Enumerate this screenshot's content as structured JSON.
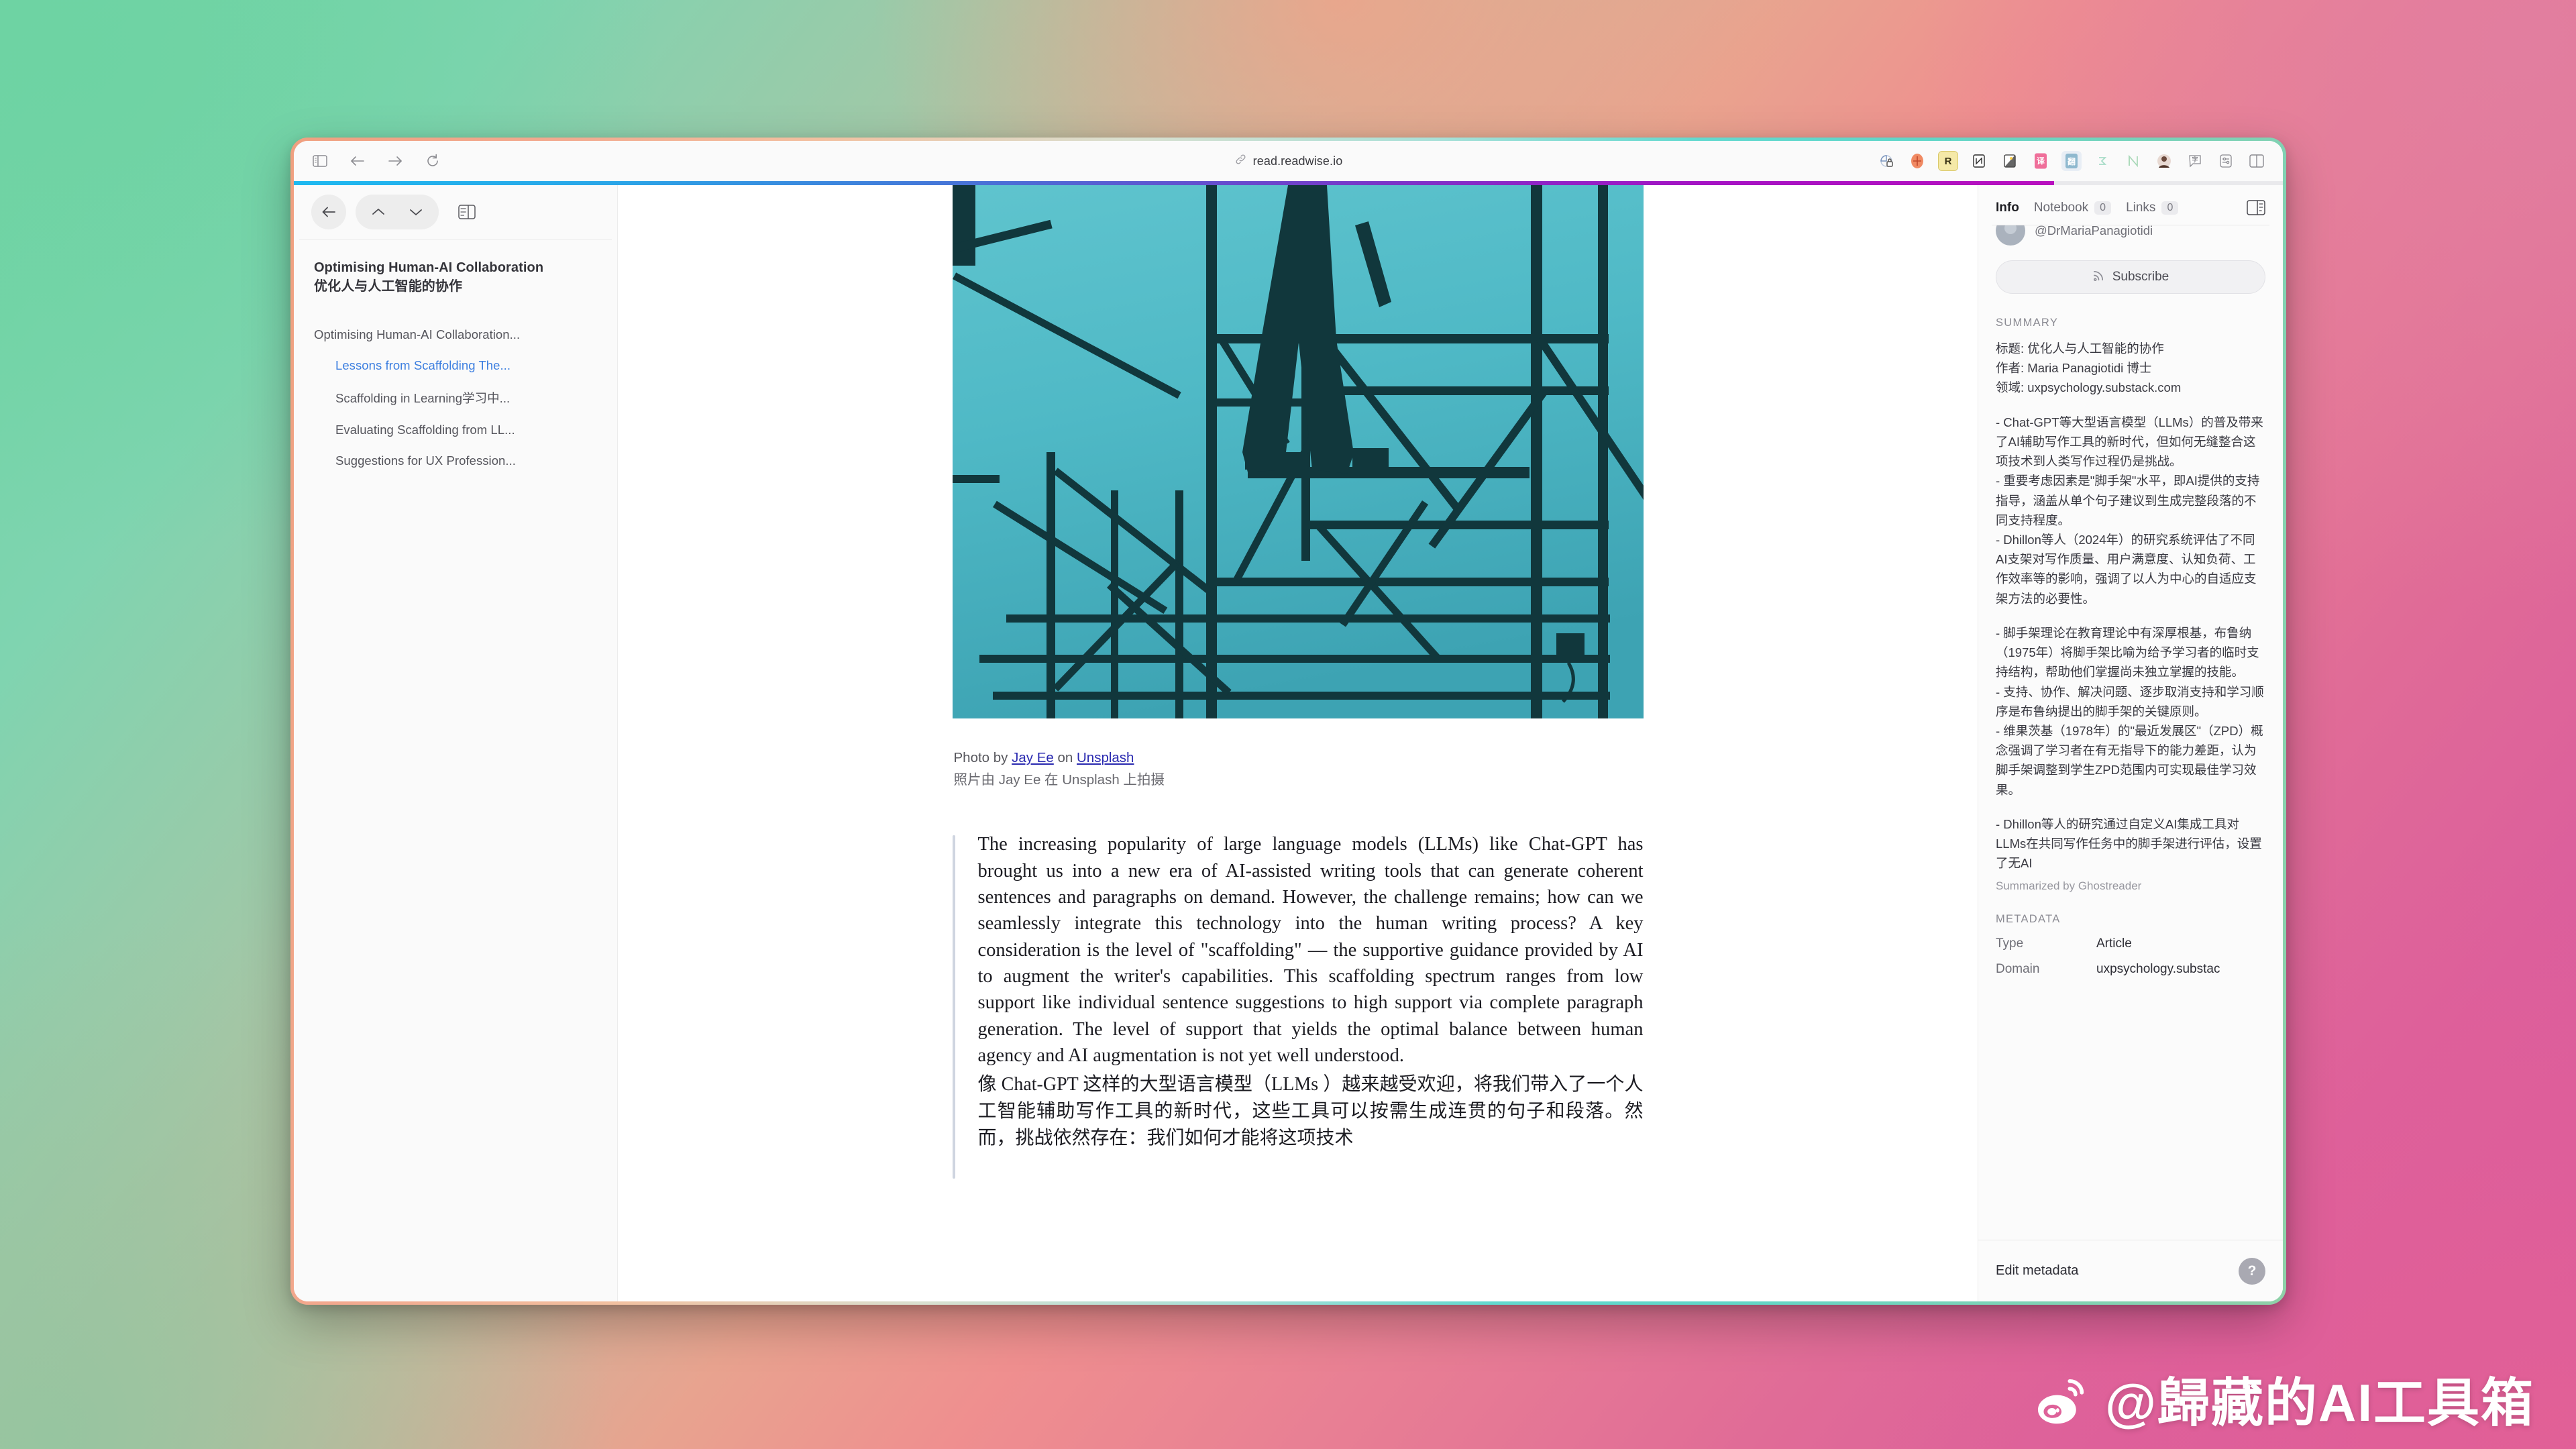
{
  "browser": {
    "url": "read.readwise.io",
    "nav": {
      "sidebar_toggle": "sidebar-toggle",
      "back": "back",
      "forward": "forward",
      "reload": "reload"
    },
    "extensions": [
      {
        "name": "privacy-badger-icon",
        "glyph": "◕"
      },
      {
        "name": "orange-cross-extension-icon",
        "glyph": "✛"
      },
      {
        "name": "readwise-extension-icon",
        "glyph": "R"
      },
      {
        "name": "notion-web-clipper-icon",
        "glyph": "Ⓝ"
      },
      {
        "name": "dark-reader-icon",
        "glyph": "☾"
      },
      {
        "name": "translate-extension-icon",
        "glyph": "译"
      },
      {
        "name": "immersive-translate-icon",
        "glyph": "翻"
      },
      {
        "name": "sigma-extension-icon",
        "glyph": "σ"
      },
      {
        "name": "n-extension-icon",
        "glyph": "N"
      },
      {
        "name": "profile-avatar-icon",
        "glyph": "●"
      },
      {
        "name": "comment-extension-icon",
        "glyph": "字"
      },
      {
        "name": "settings-sliders-icon",
        "glyph": "≈"
      },
      {
        "name": "split-view-icon",
        "glyph": "▯▯"
      }
    ],
    "progress_percent": 88
  },
  "sidebar": {
    "controls": {
      "back": "back-arrow",
      "prev": "chevron-up",
      "next": "chevron-down",
      "toggle_panel": "panel-toggle"
    },
    "doc_title_en": "Optimising Human-AI Collaboration",
    "doc_title_cn": "优化人与人工智能的协作",
    "toc": [
      {
        "label": "Optimising Human-AI Collaboration...",
        "level": 1,
        "active": false
      },
      {
        "label": "Lessons from Scaffolding The...",
        "level": 2,
        "active": true
      },
      {
        "label": "Scaffolding in Learning学习中...",
        "level": 2,
        "active": false
      },
      {
        "label": "Evaluating Scaffolding from LL...",
        "level": 2,
        "active": false
      },
      {
        "label": "Suggestions for UX Profession...",
        "level": 2,
        "active": false
      }
    ]
  },
  "reader": {
    "image_alt": "scaffolding-photo",
    "caption_prefix": "Photo by ",
    "caption_author": "Jay Ee",
    "caption_mid": " on ",
    "caption_source": "Unsplash",
    "caption_cn": "照片由 Jay Ee 在 Unsplash 上拍摄",
    "paragraph_en": "The increasing popularity of large language models (LLMs) like Chat-GPT has brought us into a new era of AI-assisted writing tools that can generate coherent sentences and paragraphs on demand. However, the challenge remains; how can we seamlessly integrate this technology into the human writing process? A key consideration is the level of \"scaffolding\" — the supportive guidance provided by AI to augment the writer's capabilities. This scaffolding spectrum ranges from low support like individual sentence suggestions to high support via complete paragraph generation. The level of support that yields the optimal balance between human agency and AI augmentation is not yet well understood.",
    "paragraph_cn": "像 Chat-GPT 这样的大型语言模型（LLMs ）越来越受欢迎，将我们带入了一个人工智能辅助写作工具的新时代，这些工具可以按需生成连贯的句子和段落。然而，挑战依然存在：我们如何才能将这项技术"
  },
  "info": {
    "tabs": [
      {
        "label": "Info",
        "count": null,
        "active": true
      },
      {
        "label": "Notebook",
        "count": "0",
        "active": false
      },
      {
        "label": "Links",
        "count": "0",
        "active": false
      }
    ],
    "panel_toggle": "info-panel-toggle",
    "author_handle": "@DrMariaPanagiotidi",
    "subscribe_label": "Subscribe",
    "summary_heading": "SUMMARY",
    "summary_lines": [
      "标题: 优化人与人工智能的协作",
      "作者: Maria Panagiotidi 博士",
      "领域: uxpsychology.substack.com"
    ],
    "summary_bullets_1": [
      "- Chat-GPT等大型语言模型（LLMs）的普及带来了AI辅助写作工具的新时代，但如何无缝整合这项技术到人类写作过程仍是挑战。",
      "- 重要考虑因素是\"脚手架\"水平，即AI提供的支持指导，涵盖从单个句子建议到生成完整段落的不同支持程度。",
      "- Dhillon等人（2024年）的研究系统评估了不同AI支架对写作质量、用户满意度、认知负荷、工作效率等的影响，强调了以人为中心的自适应支架方法的必要性。"
    ],
    "summary_bullets_2": [
      "- 脚手架理论在教育理论中有深厚根基，布鲁纳（1975年）将脚手架比喻为给予学习者的临时支持结构，帮助他们掌握尚未独立掌握的技能。",
      "- 支持、协作、解决问题、逐步取消支持和学习顺序是布鲁纳提出的脚手架的关键原则。",
      "- 维果茨基（1978年）的\"最近发展区\"（ZPD）概念强调了学习者在有无指导下的能力差距，认为脚手架调整到学生ZPD范围内可实现最佳学习效果。"
    ],
    "summary_bullets_3": [
      "- Dhillon等人的研究通过自定义AI集成工具对LLMs在共同写作任务中的脚手架进行评估，设置了无AI"
    ],
    "summarized_by": "Summarized by Ghostreader",
    "metadata_heading": "METADATA",
    "metadata_rows": [
      {
        "key": "Type",
        "value": "Article"
      },
      {
        "key": "Domain",
        "value": "uxpsychology.substac"
      }
    ],
    "edit_metadata": "Edit metadata",
    "help": "?"
  },
  "watermark": {
    "text": "@歸藏的AI工具箱",
    "logo": "weibo-logo"
  },
  "colors": {
    "accent_blue": "#3d7fe0",
    "link": "#2a2ab0",
    "bg_green": "#6ed3a3",
    "bg_pink": "#d85aa0"
  }
}
